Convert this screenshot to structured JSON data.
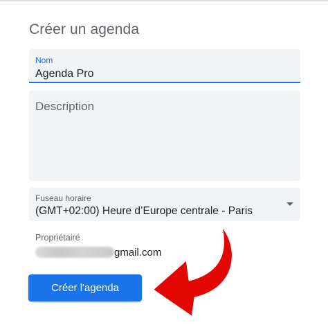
{
  "dialog": {
    "title": "Créer un agenda",
    "name_field": {
      "label": "Nom",
      "value": "Agenda Pro"
    },
    "description_field": {
      "placeholder": "Description"
    },
    "timezone_field": {
      "label": "Fuseau horaire",
      "value": "(GMT+02:00) Heure d’Europe centrale - Paris"
    },
    "owner": {
      "label": "Propriétaire",
      "email_domain": "gmail.com"
    },
    "create_button": {
      "label": "Créer l'agenda"
    }
  },
  "colors": {
    "accent": "#1a73e8",
    "annotation_arrow": "#e10600"
  },
  "icons": [
    "dropdown-caret-icon",
    "pointer-arrow-icon"
  ]
}
